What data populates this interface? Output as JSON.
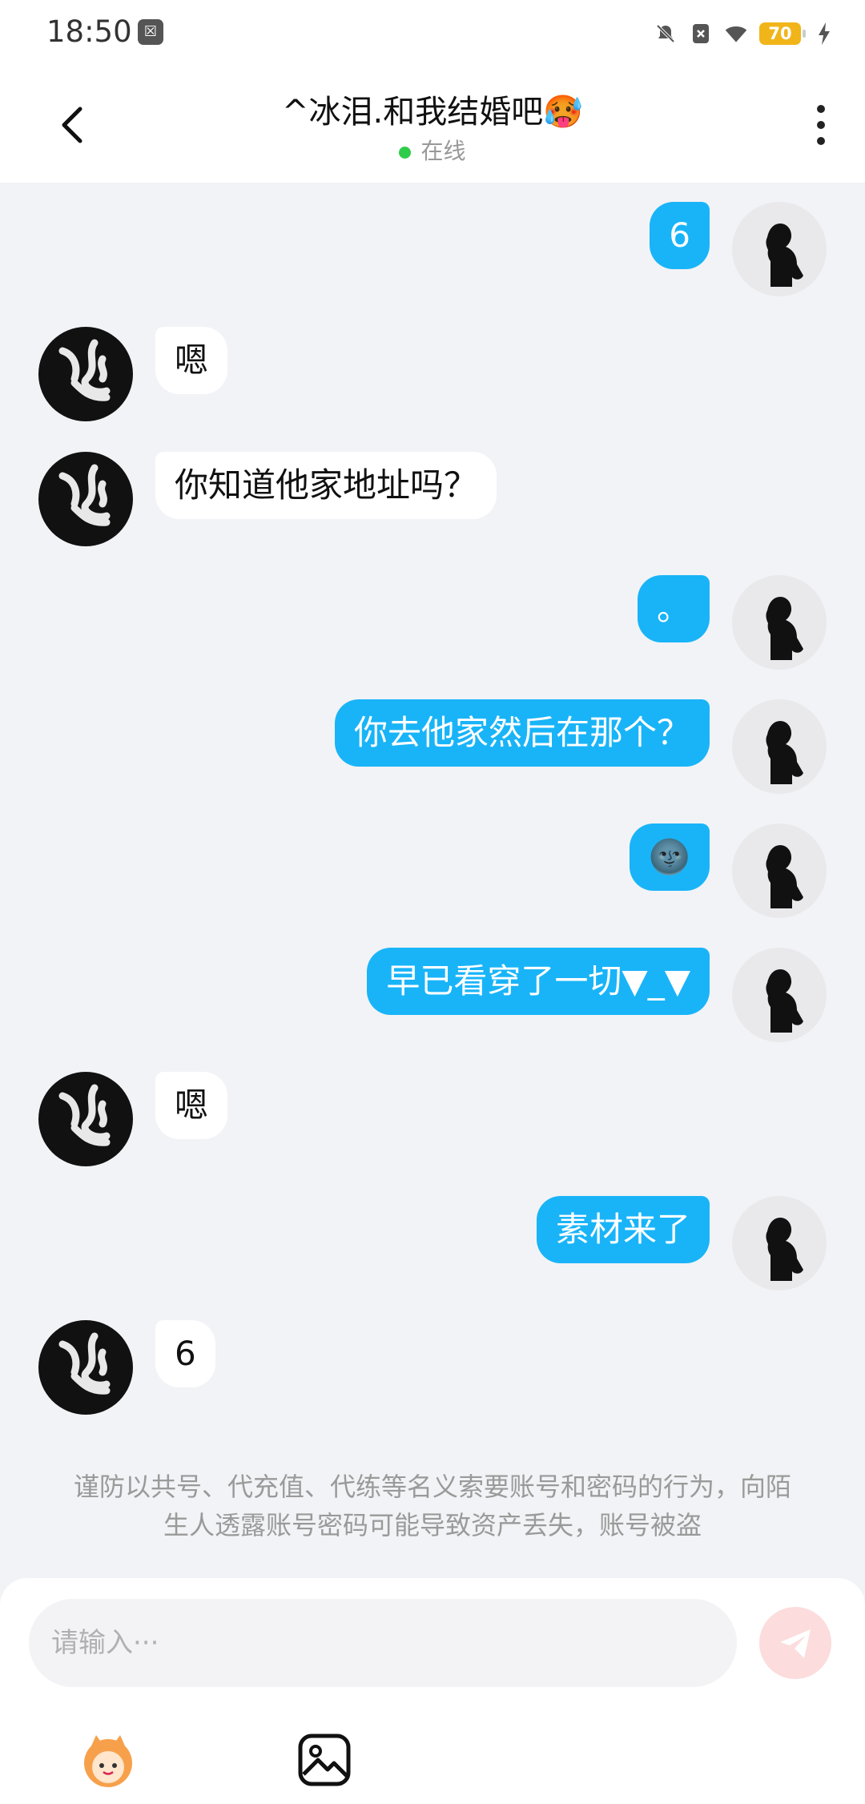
{
  "status_bar": {
    "time": "18:50",
    "battery": "70",
    "icons": [
      "app-badge-icon",
      "mute-bell-icon",
      "sim-off-icon",
      "wifi-icon",
      "battery-icon",
      "charging-bolt-icon"
    ]
  },
  "header": {
    "title": "^冰泪.和我结婚吧🥵",
    "presence": "在线",
    "icons": [
      "back-chevron-icon",
      "more-vertical-icon"
    ]
  },
  "messages": [
    {
      "side": "me",
      "text": "6"
    },
    {
      "side": "them",
      "text": "嗯"
    },
    {
      "side": "them",
      "text": "你知道他家地址吗？"
    },
    {
      "side": "me",
      "text": "。"
    },
    {
      "side": "me",
      "text": "你去他家然后在那个？"
    },
    {
      "side": "me",
      "text": "🌚"
    },
    {
      "side": "me",
      "text": "早已看穿了一切▼_▼"
    },
    {
      "side": "them",
      "text": "嗯"
    },
    {
      "side": "me",
      "text": "素材来了"
    },
    {
      "side": "them",
      "text": "6"
    }
  ],
  "notice": "谨防以共号、代充值、代练等名义索要账号和密码的行为，向陌生人透露账号密码可能导致资产丢失，账号被盗",
  "composer": {
    "placeholder": "请输入···",
    "icons": [
      "send-icon",
      "mascot-sticker-icon",
      "image-icon"
    ]
  },
  "colors": {
    "my_bubble": "#19b4f8",
    "their_bubble": "#ffffff",
    "background": "#f2f3f6",
    "online_dot": "#2fcc4a",
    "send_button": "#fcdcdc"
  }
}
